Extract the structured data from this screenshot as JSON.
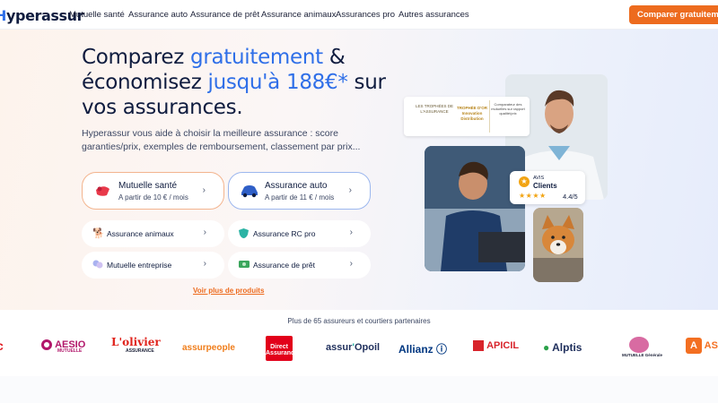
{
  "header": {
    "logo": "Hyperassur",
    "nav": [
      "Mutuelle santé",
      "Assurance auto",
      "Assurance de prêt",
      "Assurance animaux",
      "Assurances pro",
      "Autres assurances"
    ],
    "cta": "Comparer gratuitement"
  },
  "hero": {
    "line1_pre": "Comparez ",
    "line1_hl": "gratuitement",
    "line1_post": " &",
    "line2_pre": "économisez ",
    "line2_hl": "jusqu'à 188€*",
    "line2_post": " sur",
    "line3": "vos assurances.",
    "subtitle": "Hyperassur vous aide à choisir la meilleure assurance : score garanties/prix, exemples de remboursement, classement par prix..."
  },
  "products": {
    "health": {
      "title": "Mutuelle santé",
      "price": "A partir de 10 € / mois"
    },
    "auto": {
      "title": "Assurance auto",
      "price": "A partir de 11 € / mois"
    },
    "small": [
      "Assurance animaux",
      "Assurance RC pro",
      "Mutuelle entreprise",
      "Assurance de prêt"
    ],
    "more": "Voir plus de produits"
  },
  "trophy": {
    "left": "LES TROPHÉES DE L'ASSURANCE",
    "mid": "TROPHÉE D'OR Innovation Distribution",
    "right": "Comparateur des mutuelles sur rapport qualité/prix"
  },
  "review": {
    "label_small": "AVIS",
    "label": "Clients",
    "stars": "★★★★",
    "score": "4.4/5"
  },
  "partners": {
    "caption": "Plus de 65 assureurs et courtiers partenaires",
    "logos": [
      "AESIO MUTUELLE",
      "L'olivier ASSURANCE",
      "assurpeople",
      "Direct Assurance",
      "assur'Opoil",
      "Allianz",
      "GROUPE APICIL",
      "Alptis",
      "Mutuelle Générale",
      "ASSU comm"
    ]
  },
  "colors": {
    "accent": "#2f6fe8",
    "cta": "#ed6b1e",
    "navy": "#0f1c3f"
  }
}
